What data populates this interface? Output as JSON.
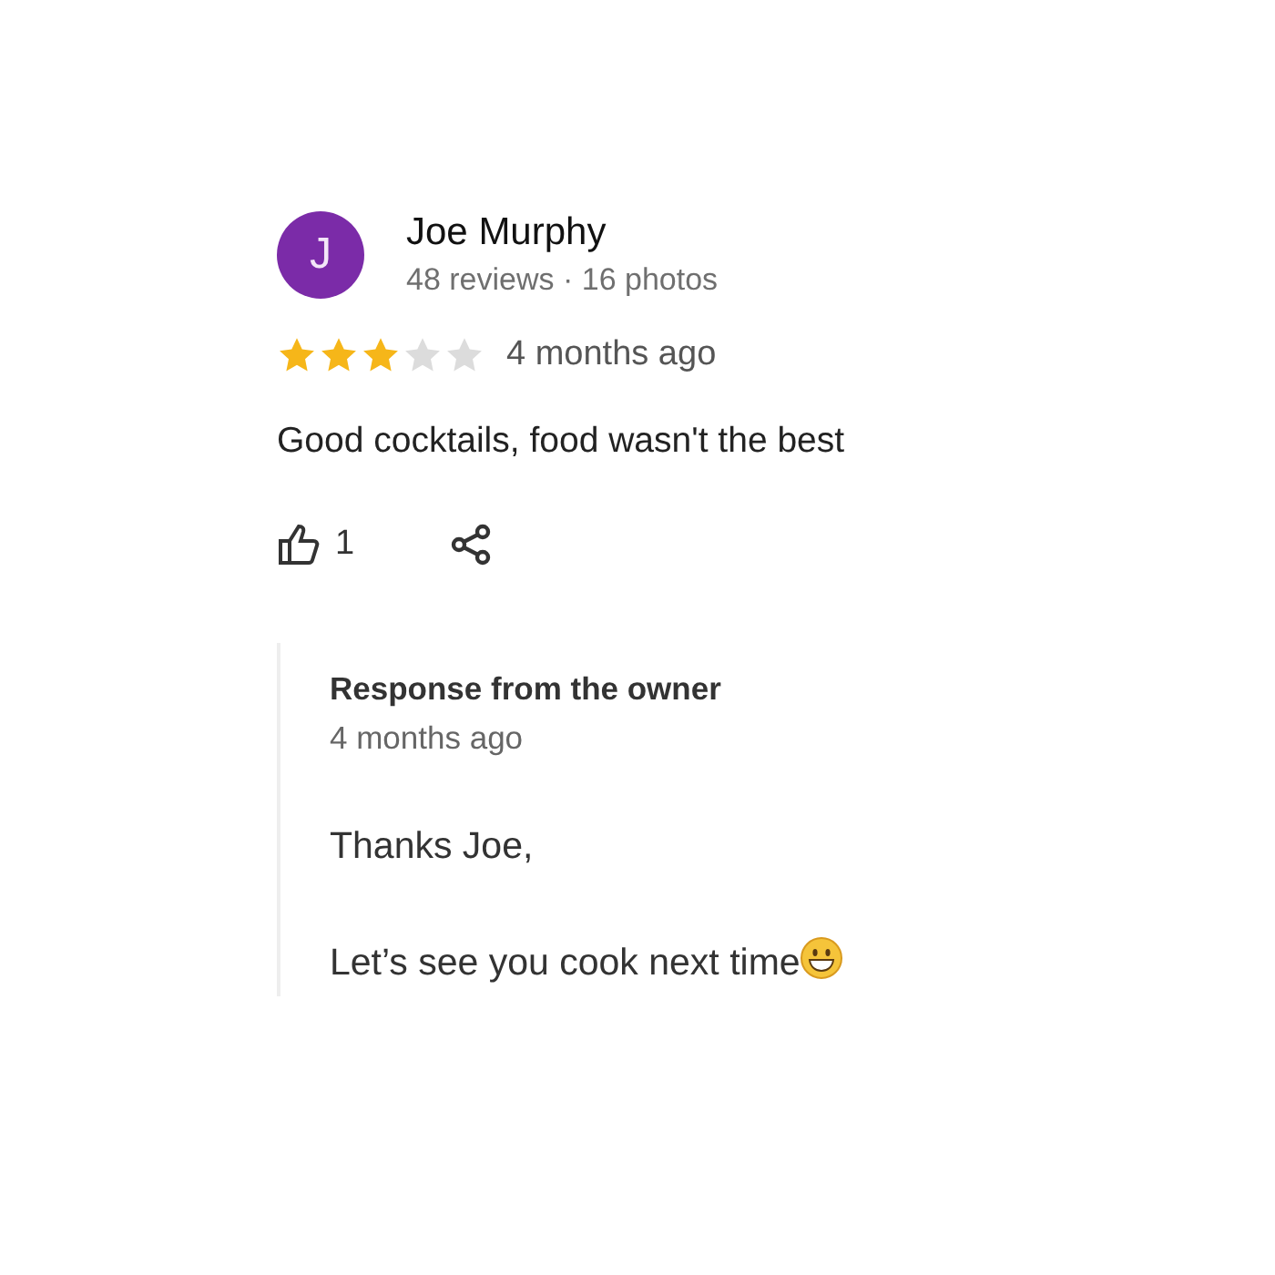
{
  "review": {
    "author_initial": "J",
    "author": "Joe Murphy",
    "author_meta": "48 reviews · 16 photos",
    "stars": 3,
    "time": "4 months ago",
    "text": "Good cocktails, food wasn't the best",
    "likes": "1"
  },
  "response": {
    "title": "Response from the owner",
    "time": "4 months ago",
    "paragraphs": [
      "Thanks Joe,",
      "Let’s see you cook next time"
    ],
    "ends_with_emoji": true
  }
}
